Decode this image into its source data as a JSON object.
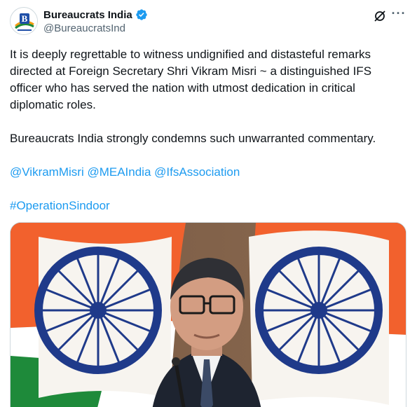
{
  "account": {
    "display_name": "Bureaucrats India",
    "handle": "@BureaucratsInd",
    "verified": true,
    "avatar_letter": "B"
  },
  "tweet": {
    "paragraph1": "It is deeply regrettable to witness undignified and distasteful remarks directed at Foreign Secretary Shri Vikram Misri ~ a distinguished IFS officer who has served the nation with utmost dedication in critical diplomatic roles.",
    "paragraph2": "Bureaucrats India strongly condemns such unwarranted commentary.",
    "mentions": [
      "@VikramMisri",
      "@MEAIndia",
      "@IfsAssociation"
    ],
    "hashtag": "#OperationSindoor"
  },
  "header_icons": [
    "grok-icon",
    "more-icon"
  ],
  "media": {
    "description_icons": [
      "india-flag-left",
      "india-flag-right",
      "speaker-photo"
    ]
  },
  "colors": {
    "link": "#1d9bf0",
    "text": "#0f1419",
    "secondary": "#536471",
    "verified": "#1d9bf0",
    "saffron": "#f2612d",
    "green": "#1e8a3a",
    "chakra": "#1f3a8a"
  }
}
